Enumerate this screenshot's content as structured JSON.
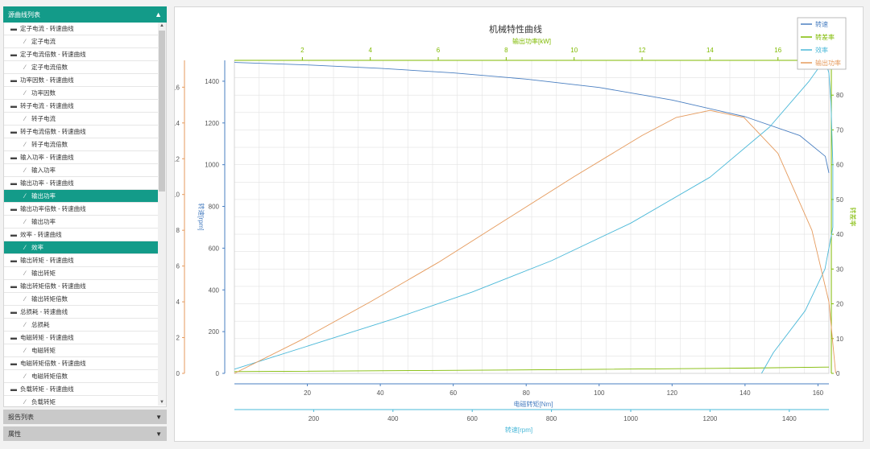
{
  "sidebar": {
    "curve_list_title": "源曲线列表",
    "items": [
      {
        "type": "folder",
        "label": "定子电流 - 转速曲线"
      },
      {
        "type": "leaf",
        "label": "定子电流"
      },
      {
        "type": "folder",
        "label": "定子电流倍数 - 转速曲线"
      },
      {
        "type": "leaf",
        "label": "定子电流倍数"
      },
      {
        "type": "folder",
        "label": "功率因数 - 转速曲线"
      },
      {
        "type": "leaf",
        "label": "功率因数"
      },
      {
        "type": "folder",
        "label": "转子电流 - 转速曲线"
      },
      {
        "type": "leaf",
        "label": "转子电流"
      },
      {
        "type": "folder",
        "label": "转子电流倍数 - 转速曲线"
      },
      {
        "type": "leaf",
        "label": "转子电流倍数"
      },
      {
        "type": "folder",
        "label": "输入功率 - 转速曲线"
      },
      {
        "type": "leaf",
        "label": "输入功率"
      },
      {
        "type": "folder",
        "label": "输出功率 - 转速曲线"
      },
      {
        "type": "leaf",
        "label": "输出功率",
        "selected": true
      },
      {
        "type": "folder",
        "label": "输出功率倍数 - 转速曲线"
      },
      {
        "type": "leaf",
        "label": "输出功率"
      },
      {
        "type": "folder",
        "label": "效率 - 转速曲线"
      },
      {
        "type": "leaf",
        "label": "效率",
        "selected": true
      },
      {
        "type": "folder",
        "label": "输出转矩 - 转速曲线"
      },
      {
        "type": "leaf",
        "label": "输出转矩"
      },
      {
        "type": "folder",
        "label": "输出转矩倍数 - 转速曲线"
      },
      {
        "type": "leaf",
        "label": "输出转矩倍数"
      },
      {
        "type": "folder",
        "label": "总损耗 - 转速曲线"
      },
      {
        "type": "leaf",
        "label": "总损耗"
      },
      {
        "type": "folder",
        "label": "电磁转矩 - 转速曲线"
      },
      {
        "type": "leaf",
        "label": "电磁转矩"
      },
      {
        "type": "folder",
        "label": "电磁转矩倍数 - 转速曲线"
      },
      {
        "type": "leaf",
        "label": "电磁转矩倍数"
      },
      {
        "type": "folder",
        "label": "负载转矩 - 转速曲线"
      },
      {
        "type": "leaf",
        "label": "负载转矩"
      }
    ],
    "report_list_title": "报告列表",
    "properties_title": "属性"
  },
  "colors": {
    "accent": "#139b89",
    "speed": "#4a7fc1",
    "slip": "#7fba00",
    "efficiency": "#4ab8d8",
    "output_power": "#e59a5c"
  },
  "chart_data": {
    "type": "line",
    "title": "机械特性曲线",
    "axes": {
      "x_bottom_inner": {
        "label": "电磁转矩[Nm]",
        "ticks": [
          20,
          40,
          60,
          80,
          100,
          120,
          140,
          160
        ],
        "range": [
          0,
          163
        ]
      },
      "x_bottom_outer": {
        "label": "转速[rpm]",
        "ticks": [
          200,
          400,
          600,
          800,
          1000,
          1200,
          1400
        ],
        "range": [
          0,
          1500
        ]
      },
      "x_top": {
        "label": "输出功率[kW]",
        "ticks": [
          2,
          4,
          6,
          8,
          10,
          12,
          14,
          16
        ],
        "range": [
          0,
          17.5
        ]
      },
      "y_left_inner": {
        "label": "转速[rpm]",
        "ticks": [
          0,
          200,
          400,
          600,
          800,
          1000,
          1200,
          1400
        ],
        "range": [
          0,
          1500
        ]
      },
      "y_left_outer": {
        "label": "输出功率[kW]",
        "ticks": [
          0,
          2,
          4,
          6,
          8,
          10,
          12,
          14,
          16
        ],
        "range": [
          0,
          17.5
        ]
      },
      "y_right": {
        "label": "转差率",
        "ticks": [
          0,
          10,
          20,
          30,
          40,
          50,
          60,
          70,
          80
        ],
        "range": [
          0,
          90
        ]
      }
    },
    "legend": [
      "转速",
      "转差率",
      "效率",
      "输出功率"
    ],
    "legend_position": "top-right",
    "grid": true,
    "series": [
      {
        "name": "转速",
        "x_axis": "x_bottom_inner",
        "y_axis": "y_left_inner",
        "points": [
          [
            0,
            1490
          ],
          [
            20,
            1478
          ],
          [
            40,
            1462
          ],
          [
            60,
            1440
          ],
          [
            80,
            1410
          ],
          [
            100,
            1370
          ],
          [
            120,
            1310
          ],
          [
            140,
            1230
          ],
          [
            155,
            1140
          ],
          [
            162,
            1040
          ],
          [
            163,
            960
          ]
        ]
      },
      {
        "name": "转差率",
        "x_axis": "x_bottom_inner",
        "y_axis": "y_right",
        "points": [
          [
            0,
            0.5
          ],
          [
            80,
            1
          ],
          [
            140,
            1.5
          ],
          [
            163,
            1.8
          ]
        ]
      },
      {
        "name": "效率",
        "x_axis": "x_bottom_outer",
        "y_axis": "y_left_inner",
        "points": [
          [
            0,
            20
          ],
          [
            200,
            140
          ],
          [
            400,
            260
          ],
          [
            600,
            390
          ],
          [
            800,
            540
          ],
          [
            1000,
            720
          ],
          [
            1200,
            940
          ],
          [
            1350,
            1180
          ],
          [
            1450,
            1400
          ],
          [
            1480,
            1480
          ],
          [
            1490,
            1500
          ],
          [
            1500,
            1440
          ],
          [
            1505,
            1300
          ],
          [
            1510,
            1000
          ],
          [
            1510,
            700
          ],
          [
            1490,
            500
          ],
          [
            1440,
            300
          ],
          [
            1360,
            100
          ],
          [
            1330,
            0
          ]
        ]
      },
      {
        "name": "输出功率",
        "x_axis": "x_top",
        "y_axis": "y_left_outer",
        "points": [
          [
            0,
            0
          ],
          [
            2,
            1.9
          ],
          [
            4,
            4.0
          ],
          [
            6,
            6.2
          ],
          [
            8,
            8.6
          ],
          [
            10,
            11.0
          ],
          [
            12,
            13.3
          ],
          [
            13,
            14.3
          ],
          [
            14,
            14.7
          ],
          [
            15,
            14.3
          ],
          [
            16,
            12.3
          ],
          [
            17,
            8.0
          ],
          [
            17.5,
            4.0
          ],
          [
            17.7,
            0
          ]
        ]
      }
    ]
  }
}
